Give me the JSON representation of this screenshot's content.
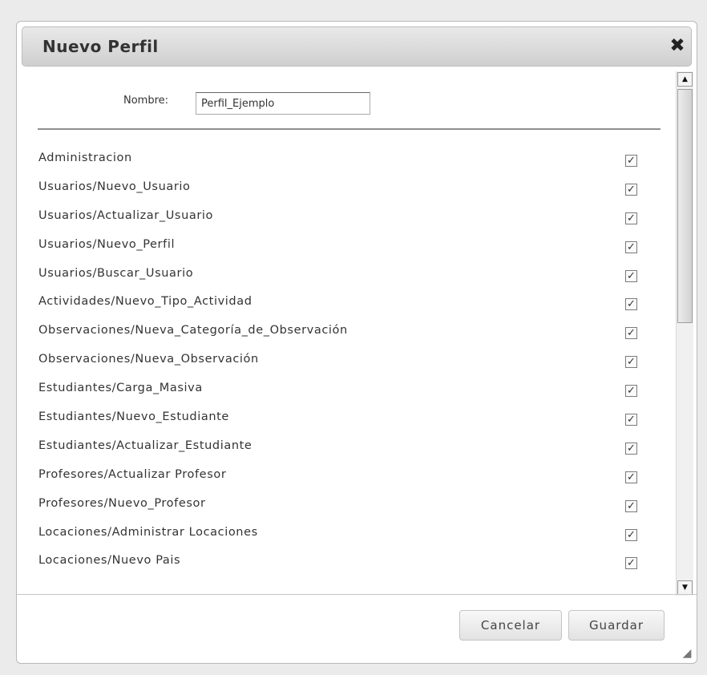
{
  "dialog": {
    "title": "Nuevo Perfil",
    "close_glyph": "✖",
    "name_label": "Nombre:",
    "name_value": "Perfil_Ejemplo",
    "permissions": [
      {
        "label": "Administracion",
        "checked": true
      },
      {
        "label": "Usuarios/Nuevo_Usuario",
        "checked": true
      },
      {
        "label": "Usuarios/Actualizar_Usuario",
        "checked": true
      },
      {
        "label": "Usuarios/Nuevo_Perfil",
        "checked": true
      },
      {
        "label": "Usuarios/Buscar_Usuario",
        "checked": true
      },
      {
        "label": "Actividades/Nuevo_Tipo_Actividad",
        "checked": true
      },
      {
        "label": "Observaciones/Nueva_Categoría_de_Observación",
        "checked": true
      },
      {
        "label": "Observaciones/Nueva_Observación",
        "checked": true
      },
      {
        "label": "Estudiantes/Carga_Masiva",
        "checked": true
      },
      {
        "label": "Estudiantes/Nuevo_Estudiante",
        "checked": true
      },
      {
        "label": "Estudiantes/Actualizar_Estudiante",
        "checked": true
      },
      {
        "label": "Profesores/Actualizar Profesor",
        "checked": true
      },
      {
        "label": "Profesores/Nuevo_Profesor",
        "checked": true
      },
      {
        "label": "Locaciones/Administrar Locaciones",
        "checked": true
      },
      {
        "label": "Locaciones/Nuevo Pais",
        "checked": true
      }
    ],
    "cancel_label": "Cancelar",
    "save_label": "Guardar"
  },
  "icons": {
    "close": "close-icon",
    "scroll_up": "scroll-up-arrow-icon",
    "scroll_down": "scroll-down-arrow-icon",
    "resize": "resize-grip-icon",
    "check": "checkmark-icon"
  },
  "colors": {
    "titlebar": "#d6d6d6",
    "page_background": "#ebebeb",
    "text": "#333333"
  }
}
